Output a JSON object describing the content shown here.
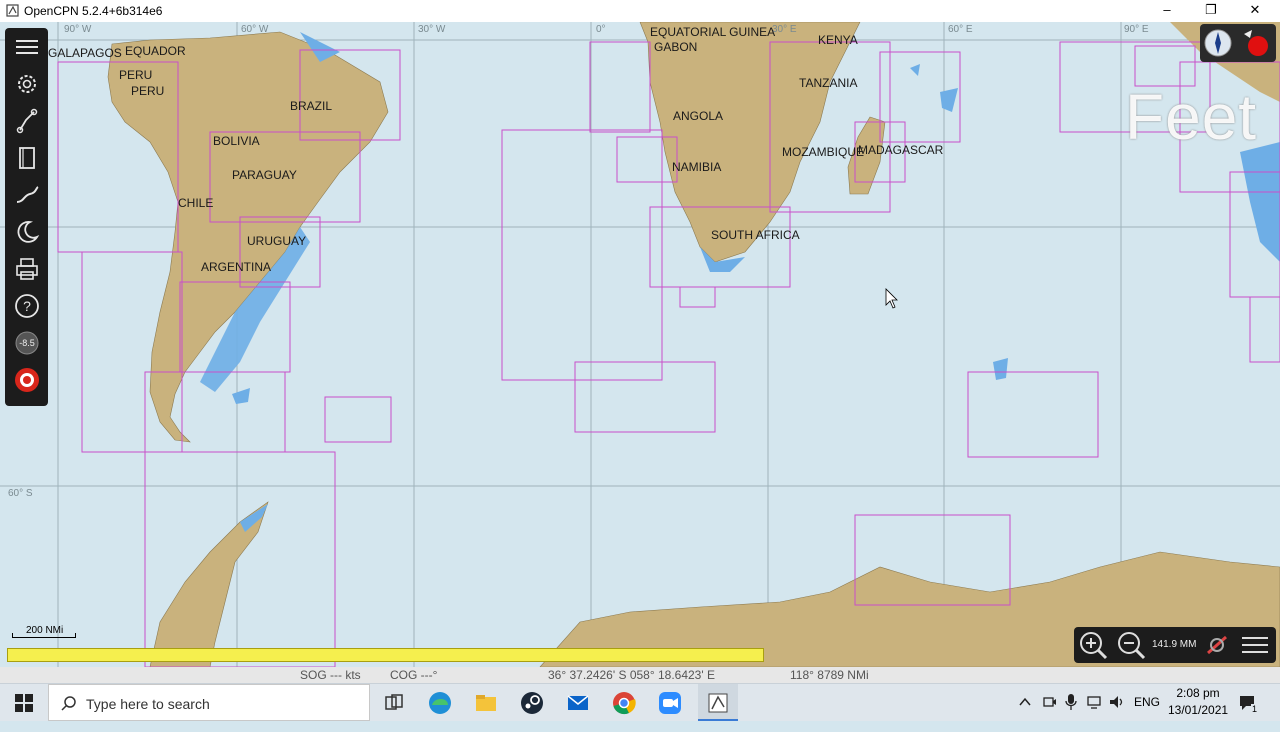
{
  "window": {
    "title": "OpenCPN 5.2.4+6b314e6",
    "minimize": "–",
    "maximize": "❐",
    "close": "✕"
  },
  "map": {
    "grid_labels": [
      "90° W",
      "60° W",
      "30° W",
      "0°",
      "30° E",
      "60° E",
      "90° E",
      "60° S"
    ],
    "countries": [
      "GALAPAGOS",
      "EQUADOR",
      "PERU",
      "PERU",
      "BRAZIL",
      "BOLIVIA",
      "PARAGUAY",
      "CHILE",
      "URUGUAY",
      "ARGENTINA",
      "EQUATORIAL GUINEA",
      "GABON",
      "KENYA",
      "TANZANIA",
      "ANGOLA",
      "MOZAMBIQUE",
      "MADAGASCAR",
      "NAMIBIA",
      "SOUTH AFRICA"
    ],
    "overlay_text": "Feet",
    "scale_bar": "200 NMi",
    "zoom_scale": "141.9 MM",
    "colors": {
      "sea": "#d4e6ee",
      "land": "#c9b27d",
      "shallow": "#6eaee6",
      "chart_outline": "#c94fc9",
      "progress": "#f5ef4e"
    }
  },
  "toolbar": {
    "items": [
      "menu-icon",
      "settings-icon",
      "route-icon",
      "chart-book-icon",
      "track-icon",
      "moon-icon",
      "print-icon",
      "help-icon",
      "tide-icon",
      "mob-icon"
    ],
    "tide_value": "-8.5"
  },
  "loading_progress": 1.0,
  "status": {
    "sog": "SOG --- kts",
    "cog": "COG ---°",
    "position": "36° 37.2426' S   058° 18.6423' E",
    "bearing": "118°  8789 NMi"
  },
  "taskbar": {
    "search_placeholder": "Type here to search",
    "language": "ENG",
    "time": "2:08 pm",
    "date": "13/01/2021",
    "notifications": "1"
  }
}
